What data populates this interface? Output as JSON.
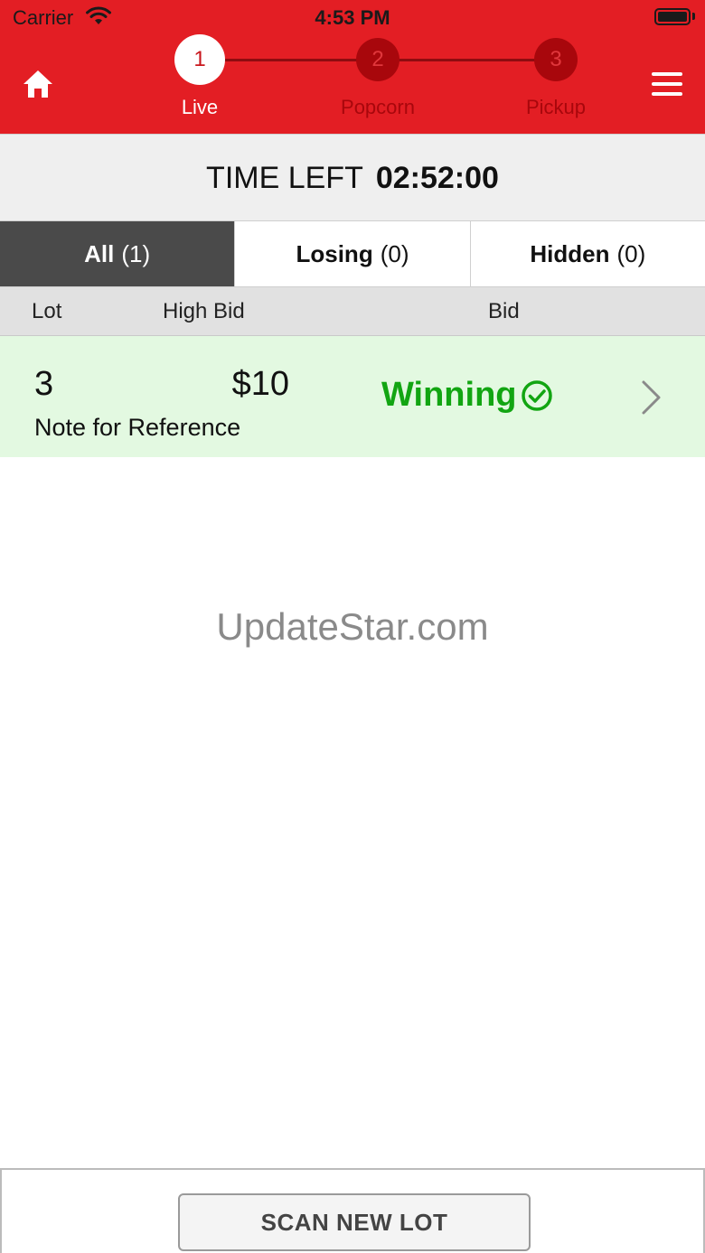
{
  "status_bar": {
    "carrier": "Carrier",
    "time": "4:53 PM"
  },
  "steps": [
    {
      "number": "1",
      "label": "Live",
      "active": true
    },
    {
      "number": "2",
      "label": "Popcorn",
      "active": false
    },
    {
      "number": "3",
      "label": "Pickup",
      "active": false
    }
  ],
  "timer": {
    "label": "TIME LEFT",
    "value": "02:52:00"
  },
  "tabs": [
    {
      "name": "All",
      "count": "(1)",
      "active": true
    },
    {
      "name": "Losing",
      "count": "(0)",
      "active": false
    },
    {
      "name": "Hidden",
      "count": "(0)",
      "active": false
    }
  ],
  "columns": {
    "lot": "Lot",
    "high_bid": "High Bid",
    "bid": "Bid"
  },
  "lots": [
    {
      "number": "3",
      "note": "Note for Reference",
      "high_bid": "$10",
      "status": "Winning"
    }
  ],
  "watermark": "UpdateStar.com",
  "scan_button": "SCAN NEW LOT",
  "colors": {
    "brand_red": "#e31e24",
    "winning_green": "#12a512",
    "row_highlight": "#e3f9e1"
  }
}
